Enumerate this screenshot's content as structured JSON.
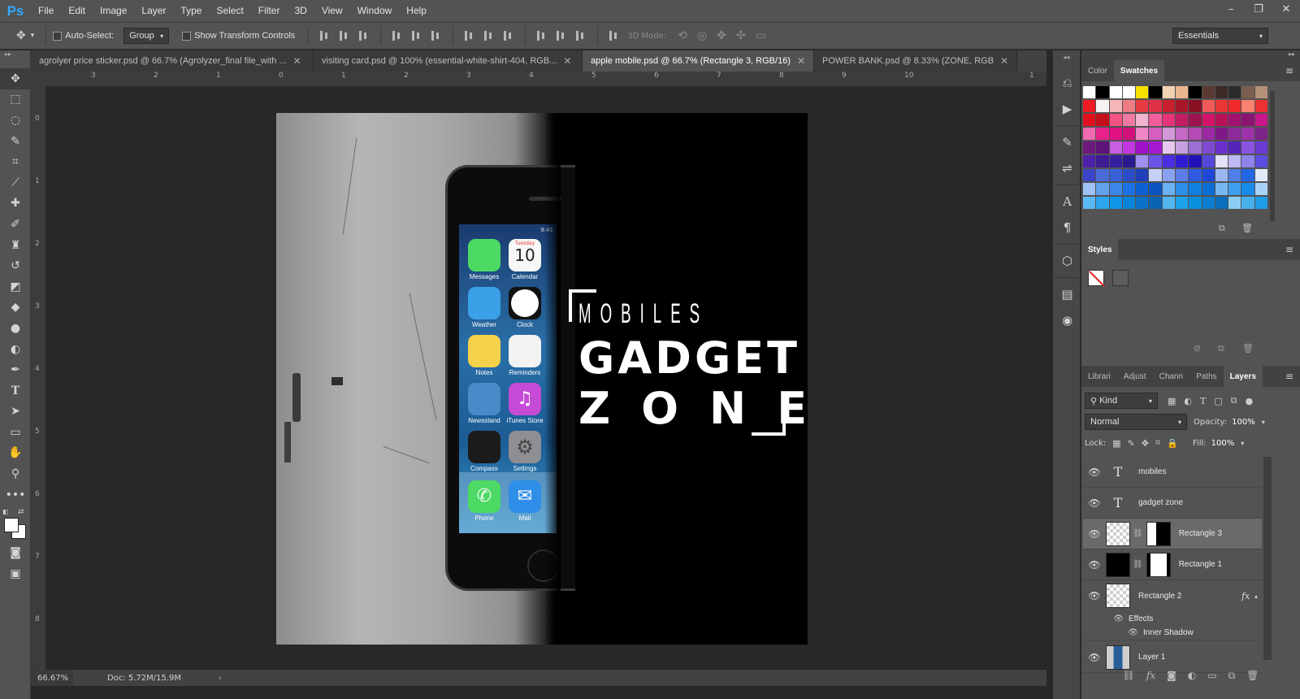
{
  "app": {
    "logo": "Ps"
  },
  "menu": [
    "File",
    "Edit",
    "Image",
    "Layer",
    "Type",
    "Select",
    "Filter",
    "3D",
    "View",
    "Window",
    "Help"
  ],
  "window_controls": [
    "–",
    "❐",
    "✕"
  ],
  "options": {
    "auto_select_label": "Auto-Select:",
    "auto_select_value": "Group",
    "show_transform_label": "Show Transform Controls",
    "mode_3d_label": "3D Mode:",
    "workspace": "Essentials"
  },
  "tabs": [
    {
      "label": "agrolyer price sticker.psd @ 66.7% (Agrolyzer_final file_with ...",
      "active": false
    },
    {
      "label": "visiting card.psd @ 100% (essential-white-shirt-404, RGB...",
      "active": false
    },
    {
      "label": "apple mobile.psd @ 66.7% (Rectangle 3, RGB/16)",
      "active": true
    },
    {
      "label": "POWER BANK.psd @ 8.33% (ZONE, RGB...",
      "active": false
    }
  ],
  "rulers": {
    "top": [
      "3",
      "2",
      "1",
      "0",
      "1",
      "2",
      "3",
      "4",
      "5",
      "6",
      "7",
      "8",
      "9",
      "10",
      "1"
    ],
    "left": [
      "0",
      "1",
      "2",
      "3",
      "4",
      "5",
      "6",
      "7",
      "8"
    ]
  },
  "artwork": {
    "line1": "MOBILES",
    "line2": "GADGET",
    "line3": "ZONE",
    "apps": [
      {
        "label": "Messages",
        "color": "#4cd964"
      },
      {
        "label": "Calendar",
        "color": "#f7f7f7"
      },
      {
        "label": "Weather",
        "color": "#3aa0e8"
      },
      {
        "label": "Clock",
        "color": "#111111"
      },
      {
        "label": "Notes",
        "color": "#f4d14a"
      },
      {
        "label": "Reminders",
        "color": "#f2f2f2"
      },
      {
        "label": "Newsstand",
        "color": "#4a8ac9"
      },
      {
        "label": "iTunes Store",
        "color": "#c54bd6"
      },
      {
        "label": "Compass",
        "color": "#1b1b1b"
      },
      {
        "label": "Settings",
        "color": "#8e8e93"
      },
      {
        "label": "Phone",
        "color": "#4cd964"
      },
      {
        "label": "Mail",
        "color": "#2f8ee8"
      }
    ],
    "calendar_day": "Tuesday",
    "calendar_date": "10",
    "clock_time": "9:41"
  },
  "status": {
    "zoom": "66.67%",
    "doc": "Doc: 5.72M/15.9M"
  },
  "panels": {
    "color_tab": "Color",
    "swatches_tab": "Swatches",
    "styles_tab": "Styles",
    "layer_tabs": [
      "Librari",
      "Adjust",
      "Chann",
      "Paths",
      "Layers"
    ],
    "filter_kind": "Kind",
    "blend_mode": "Normal",
    "opacity_label": "Opacity:",
    "opacity_value": "100%",
    "lock_label": "Lock:",
    "fill_label": "Fill:",
    "fill_value": "100%"
  },
  "swatch_rows": [
    [
      "#ffffff",
      "#000000",
      "#ffffff",
      "#ffffff",
      "#f7e100",
      "#000000",
      "#f3d1b3",
      "#eab690",
      "#000000",
      "#5a3a33",
      "#3b2a27",
      "#2b2b2b",
      "#7a5f4e",
      "#b59179"
    ],
    [
      "#ed1c24",
      "#f7f1f1",
      "#f4b6b8",
      "#ee7d83",
      "#e63b42",
      "#df3147",
      "#c8202f",
      "#a8162a",
      "#8a1024",
      "#f25a5a",
      "#e83535",
      "#ee2a2a",
      "#f98172",
      "#ed3236"
    ],
    [
      "#e2101e",
      "#c50e1c",
      "#f45482",
      "#f07aa3",
      "#f3b4cf",
      "#f25d9c",
      "#e53479",
      "#c21c63",
      "#9d1350",
      "#d4146a",
      "#b8115a",
      "#a3116f",
      "#8b1371",
      "#c8178a"
    ],
    [
      "#f06ab0",
      "#e8218b",
      "#e11283",
      "#cf1279",
      "#ef86c5",
      "#d45ebf",
      "#d399d8",
      "#c469c4",
      "#b44ab5",
      "#9a29a3",
      "#7e1a87",
      "#8e2a9b",
      "#9c33a9",
      "#7d2689"
    ],
    [
      "#6d1a7e",
      "#5c147a",
      "#c75fe0",
      "#c238e0",
      "#9f12c8",
      "#a41ad0",
      "#e7c9ef",
      "#c6a0df",
      "#9b6fd4",
      "#7e4bd0",
      "#6a2fcb",
      "#5425b6",
      "#8a54e0",
      "#6a3bd3"
    ],
    [
      "#4e20a8",
      "#3e1b95",
      "#3620a1",
      "#2a1a8f",
      "#a08ef0",
      "#6a54e8",
      "#4a2ee0",
      "#2f1bd2",
      "#2012b7",
      "#5448d8",
      "#e3e1f8",
      "#bdb7f2",
      "#8d84ea",
      "#5a4de0"
    ],
    [
      "#3b45c8",
      "#4a6ad8",
      "#3a60d8",
      "#2b4ec8",
      "#1e3fb8",
      "#c4d0f4",
      "#8aa3ee",
      "#5c7de8",
      "#2f5be0",
      "#1d47d6",
      "#9bb7f2",
      "#4f7ee8",
      "#2266e4",
      "#e1e9fa"
    ],
    [
      "#9fc2f4",
      "#62a1ee",
      "#3b88e8",
      "#1c72e2",
      "#0d5fd4",
      "#0a54c2",
      "#6ab2f2",
      "#2d8fe8",
      "#117fe0",
      "#0b6ed2",
      "#77b8f4",
      "#3e9ff0",
      "#168be8",
      "#a9d2f7"
    ],
    [
      "#5cb8f3",
      "#2ea5ef",
      "#1094e8",
      "#0a83da",
      "#0a72c8",
      "#0a63b3",
      "#54b6ee",
      "#1da2ea",
      "#0b90de",
      "#0b7ecf",
      "#0a6ebc",
      "#8bcdf2",
      "#47b0ec",
      "#1f9de6"
    ]
  ],
  "layers": [
    {
      "name": "mobiles",
      "type": "text",
      "selected": false
    },
    {
      "name": "gadget zone",
      "type": "text",
      "selected": false
    },
    {
      "name": "Rectangle 3",
      "type": "shape-mask",
      "selected": true
    },
    {
      "name": "Rectangle 1",
      "type": "shape-mask",
      "selected": false
    },
    {
      "name": "Rectangle 2",
      "type": "shape-fx",
      "selected": false
    },
    {
      "name": "Layer 1",
      "type": "pixel",
      "selected": false
    }
  ],
  "effects": {
    "label": "Effects",
    "inner_shadow": "Inner Shadow",
    "fx": "fx"
  }
}
